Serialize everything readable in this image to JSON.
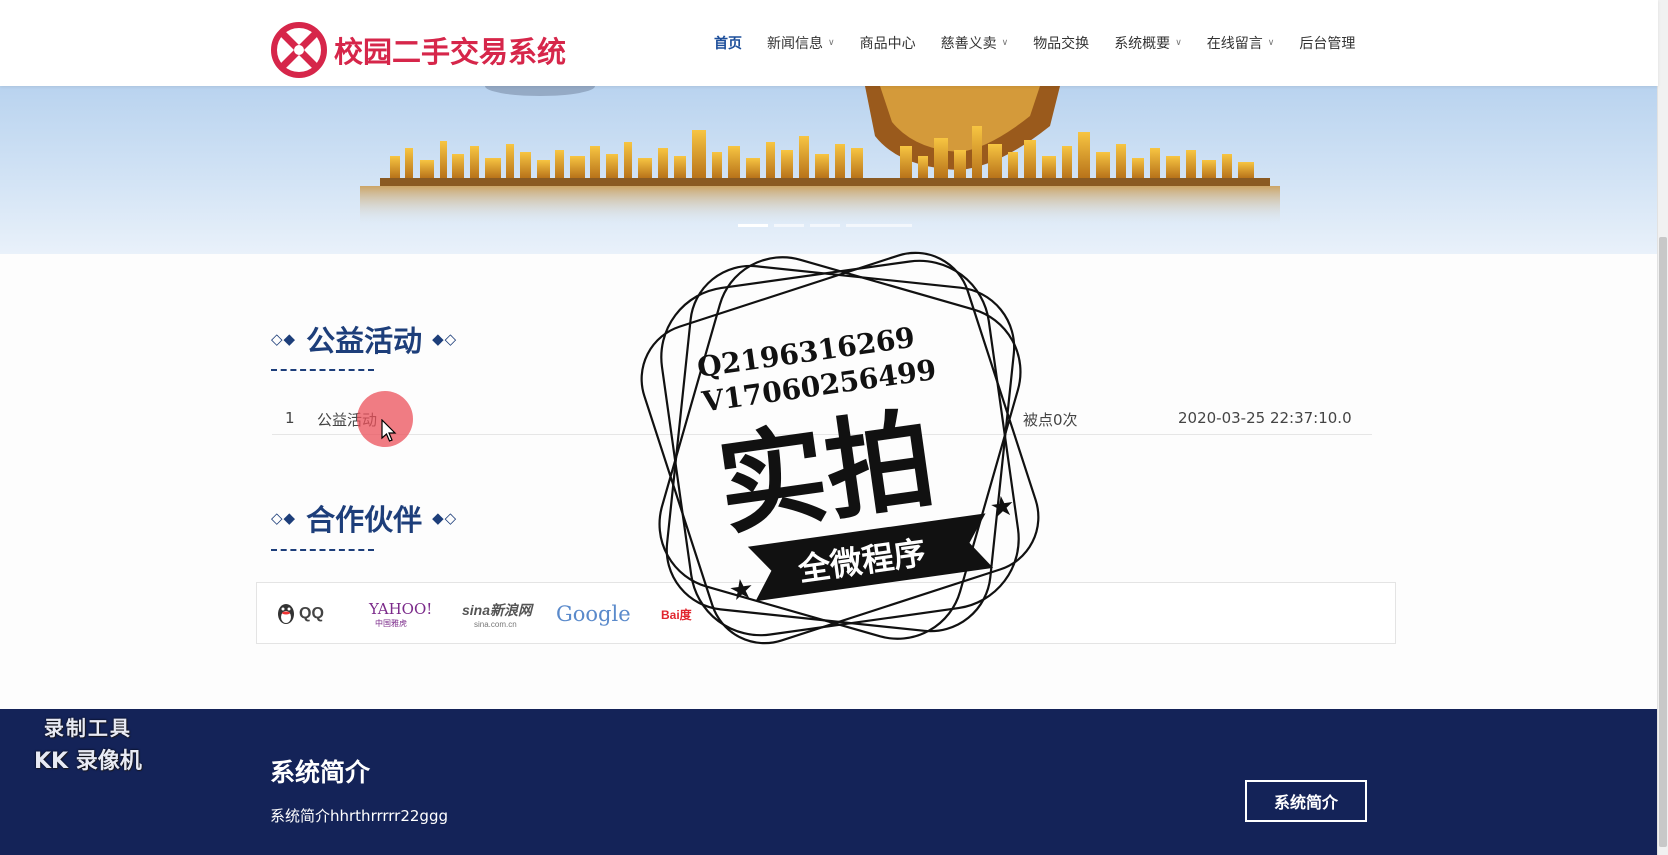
{
  "header": {
    "site_title": "校园二手交易系统",
    "nav": [
      {
        "label": "首页",
        "active": true,
        "dropdown": false
      },
      {
        "label": "新闻信息",
        "active": false,
        "dropdown": true
      },
      {
        "label": "商品中心",
        "active": false,
        "dropdown": false
      },
      {
        "label": "慈善义卖",
        "active": false,
        "dropdown": true
      },
      {
        "label": "物品交换",
        "active": false,
        "dropdown": false
      },
      {
        "label": "系统概要",
        "active": false,
        "dropdown": true
      },
      {
        "label": "在线留言",
        "active": false,
        "dropdown": true
      },
      {
        "label": "后台管理",
        "active": false,
        "dropdown": false
      }
    ]
  },
  "banner": {
    "slides": 4,
    "active_slide": 0
  },
  "activities": {
    "title": "公益活动",
    "rows": [
      {
        "index": "1",
        "name": "公益活动",
        "views": "被点0次",
        "time": "2020-03-25 22:37:10.0"
      }
    ]
  },
  "partners": {
    "title": "合作伙伴",
    "items": [
      {
        "name": "QQ"
      },
      {
        "name": "YAHOO!",
        "sub": "中国雅虎"
      },
      {
        "name": "sina新浪网",
        "sub": "sina.com.cn"
      },
      {
        "name": "Google"
      },
      {
        "name": "Bai度"
      }
    ]
  },
  "stamp": {
    "line1": "Q2196316269",
    "line2": "V17060256499",
    "big": "实拍",
    "ribbon": "全微程序"
  },
  "footer": {
    "title": "系统简介",
    "text": "系统简介hhrthrrrrr22ggg",
    "button": "系统简介"
  },
  "watermark": {
    "line1": "录制工具",
    "line2": "KK 录像机"
  },
  "colors": {
    "brand_red": "#d6264a",
    "navy": "#1d3e7a",
    "footer_bg": "#142358"
  }
}
